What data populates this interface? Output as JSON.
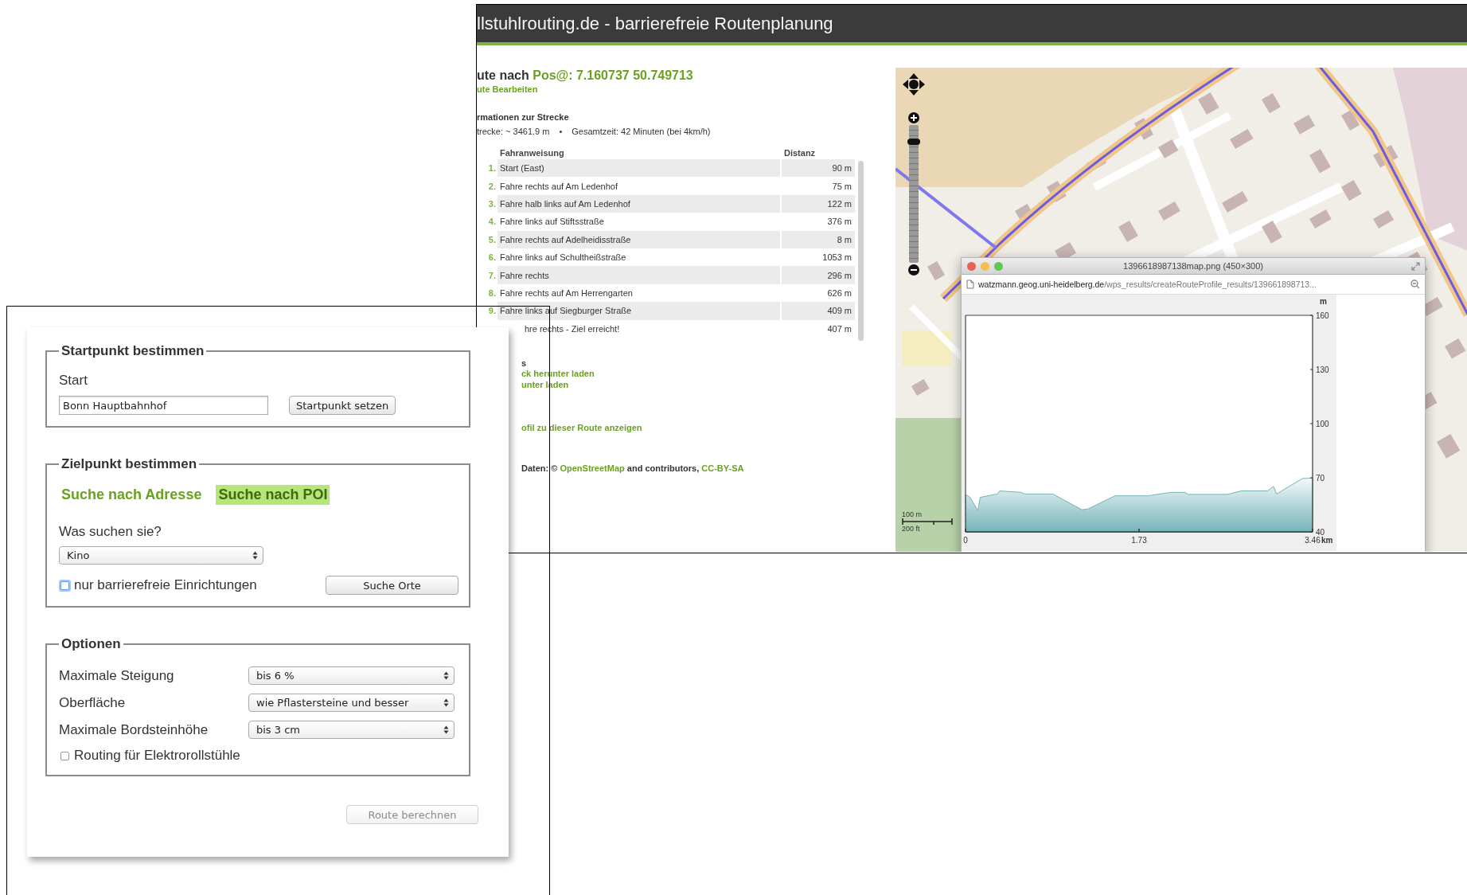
{
  "background_page": {
    "title": "llstuhlrouting.de - barrierefreie Routenplanung",
    "route_heading": {
      "prefix": "ute nach",
      "target": "Pos@: 7.160737 50.749713"
    },
    "edit_link": "ute Bearbeiten",
    "info_heading": "rmationen zur Strecke",
    "stats": [
      "trecke: ~ 3461.9 m",
      "•",
      "Gesamtzeit: 42 Minuten (bei 4km/h)"
    ],
    "directions": {
      "columns": [
        "Fahranweisung",
        "Distanz"
      ],
      "rows": [
        {
          "number": "1.",
          "instruction": "Start (East)",
          "distance": "90 m"
        },
        {
          "number": "2.",
          "instruction": "Fahre rechts auf Am Ledenhof",
          "distance": "75 m"
        },
        {
          "number": "3.",
          "instruction": "Fahre halb links auf Am Ledenhof",
          "distance": "122 m"
        },
        {
          "number": "4.",
          "instruction": "Fahre links auf Stiftsstraße",
          "distance": "376 m"
        },
        {
          "number": "5.",
          "instruction": "Fahre rechts auf Adelheidisstraße",
          "distance": "8 m"
        },
        {
          "number": "6.",
          "instruction": "Fahre links auf Schultheißstraße",
          "distance": "1053 m"
        },
        {
          "number": "7.",
          "instruction": "Fahre rechts",
          "distance": "296 m"
        },
        {
          "number": "8.",
          "instruction": "Fahre rechts auf Am Herrengarten",
          "distance": "626 m"
        },
        {
          "number": "9.",
          "instruction": "Fahre links auf Siegburger Straße",
          "distance": "409 m"
        },
        {
          "instruction": "hre rechts - Ziel erreicht!",
          "distance": "407 m"
        }
      ]
    },
    "section_stub": "s",
    "download_links": [
      "ck herunter laden",
      "unter laden"
    ],
    "profile_link": "ofil zu dieser Route anzeigen",
    "attribution": {
      "prefix": "Daten: ©",
      "osm_link": "OpenStreetMap",
      "middle": "and contributors,",
      "license_link": "CC-BY-SA"
    },
    "map": {
      "zoom_slider": {
        "level": 0.9
      },
      "scale_bar": [
        "100 m",
        "200 ft"
      ],
      "image_window": {
        "title": "1396618987138map.png (450×300)",
        "url_host": "watzmann.geog.uni-heidelberg.de",
        "url_path": "/wps_results/createRouteProfile_results/139661898713...",
        "chart_data": {
          "type": "area",
          "xlabel": "km",
          "ylabel": "m",
          "x": [
            0,
            0.044,
            0.124,
            0.146,
            0.32,
            0.34,
            0.56,
            0.59,
            0.87,
            1.16,
            1.22,
            1.49,
            1.82,
            2.04,
            2.19,
            2.22,
            2.61,
            2.75,
            3.01,
            3.07,
            3.1,
            3.36,
            3.46
          ],
          "series": [
            {
              "color": "#74b3b8",
              "values": [
                60.8,
                59.2,
                51.9,
                59.2,
                61,
                62.7,
                61.9,
                61,
                61,
                52.3,
                52.7,
                60,
                60,
                61.9,
                61.9,
                60.8,
                60.8,
                62.7,
                62.7,
                65.2,
                61,
                69.6,
                69.8
              ]
            }
          ],
          "xlim": [
            0,
            3.46
          ],
          "ylim": [
            40,
            160
          ],
          "xticks": [
            0,
            1.73,
            3.46
          ],
          "yticks": [
            40,
            70,
            100,
            130,
            160
          ]
        }
      }
    }
  },
  "form": {
    "sections": [
      {
        "kind": "start",
        "legend": "Startpunkt bestimmen",
        "label": "Start",
        "input_value": "Bonn Hauptbahnhof",
        "button": "Startpunkt setzen"
      },
      {
        "kind": "destination",
        "legend": "Zielpunkt bestimmen",
        "tabs": [
          {
            "label": "Suche nach Adresse",
            "selected": false
          },
          {
            "label": "Suche nach POI",
            "selected": true
          }
        ],
        "question": "Was suchen sie?",
        "select_value": "Kino",
        "checkbox": {
          "label": "nur barrierefreie Einrichtungen",
          "checked": false,
          "focused": true
        },
        "button": "Suche Orte"
      },
      {
        "kind": "options",
        "legend": "Optionen",
        "rows": [
          {
            "label": "Maximale Steigung",
            "value": "bis 6 %"
          },
          {
            "label": "Oberfläche",
            "value": "wie Pflastersteine und besser"
          },
          {
            "label": "Maximale Bordsteinhöhe",
            "value": "bis 3 cm"
          }
        ],
        "checkbox": {
          "label": "Routing für Elektrorollstühle",
          "checked": false
        }
      }
    ],
    "submit": {
      "label": "Route berechnen",
      "disabled": true
    }
  }
}
